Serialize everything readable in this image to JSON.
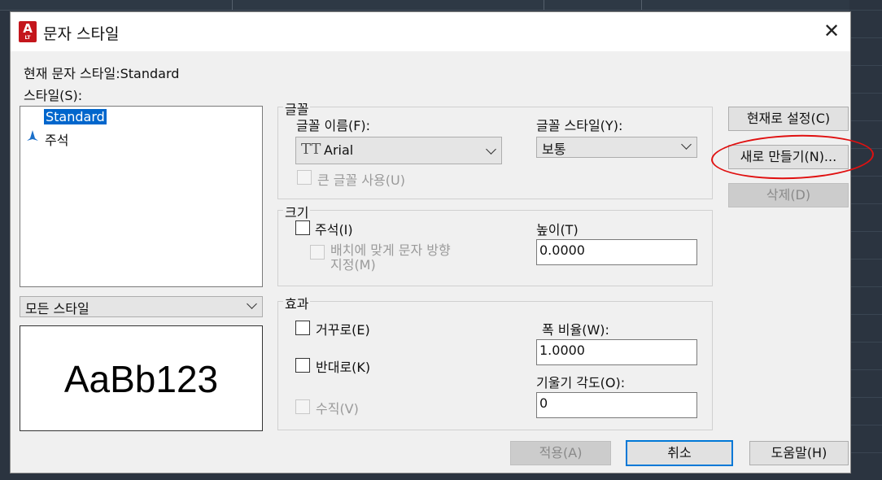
{
  "dialog": {
    "title": "문자 스타일",
    "close_glyph": "✕",
    "app_badge": "A",
    "app_badge_sub": "LT"
  },
  "current_style": {
    "label": "현재 문자 스타일:",
    "value": "Standard"
  },
  "styles": {
    "label": "스타일(S):",
    "items": [
      {
        "label": "Standard",
        "selected": true
      },
      {
        "label": "주석",
        "annotative": true
      }
    ]
  },
  "filter": {
    "value": "모든 스타일"
  },
  "preview": {
    "text": "AaBb123"
  },
  "font": {
    "group_label": "글꼴",
    "name_label": "글꼴 이름(F):",
    "name_value": "Arial",
    "name_icon_glyph": "TT",
    "style_label": "글꼴 스타일(Y):",
    "style_value": "보통",
    "big_font_label": "큰 글꼴 사용(U)"
  },
  "size": {
    "group_label": "크기",
    "annotative_label": "주석(I)",
    "match_orientation_label_line1": "배치에 맞게 문자 방향",
    "match_orientation_label_line2": "지정(M)",
    "height_label": "높이(T)",
    "height_value": "0.0000"
  },
  "effects": {
    "group_label": "효과",
    "upside_down_label": "거꾸로(E)",
    "backwards_label": "반대로(K)",
    "vertical_label": "수직(V)",
    "width_factor_label": "폭 비율(W):",
    "width_factor_value": "1.0000",
    "oblique_label": "기울기 각도(O):",
    "oblique_value": "0"
  },
  "buttons": {
    "set_current": "현재로 설정(C)",
    "new": "새로 만들기(N)...",
    "delete": "삭제(D)",
    "apply": "적용(A)",
    "cancel": "취소",
    "help": "도움말(H)"
  },
  "colors": {
    "selection": "#0066cc",
    "app_icon": "#c4161c",
    "annotation_marker": "#e01010",
    "annotative_icon": "#1a6fc9"
  }
}
